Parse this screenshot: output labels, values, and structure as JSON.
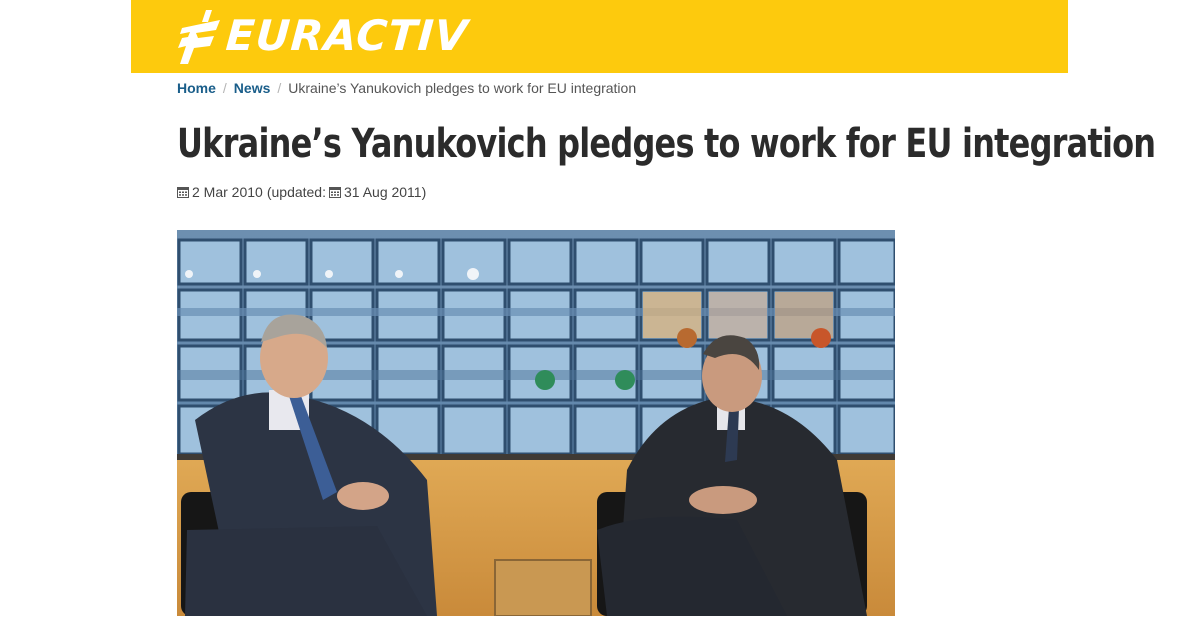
{
  "site": {
    "brand": "EURACTIV",
    "header_color": "#fdca0d"
  },
  "breadcrumb": {
    "home": "Home",
    "news": "News",
    "current": "Ukraine’s Yanukovich pledges to work for EU integration"
  },
  "article": {
    "title": "Ukraine’s Yanukovich pledges to work for EU integration",
    "date_published": "2 Mar 2010",
    "updated_prefix": "(updated:",
    "date_updated": "31 Aug 2011)",
    "icons": [
      "calendar-icon",
      "calendar-icon"
    ]
  }
}
